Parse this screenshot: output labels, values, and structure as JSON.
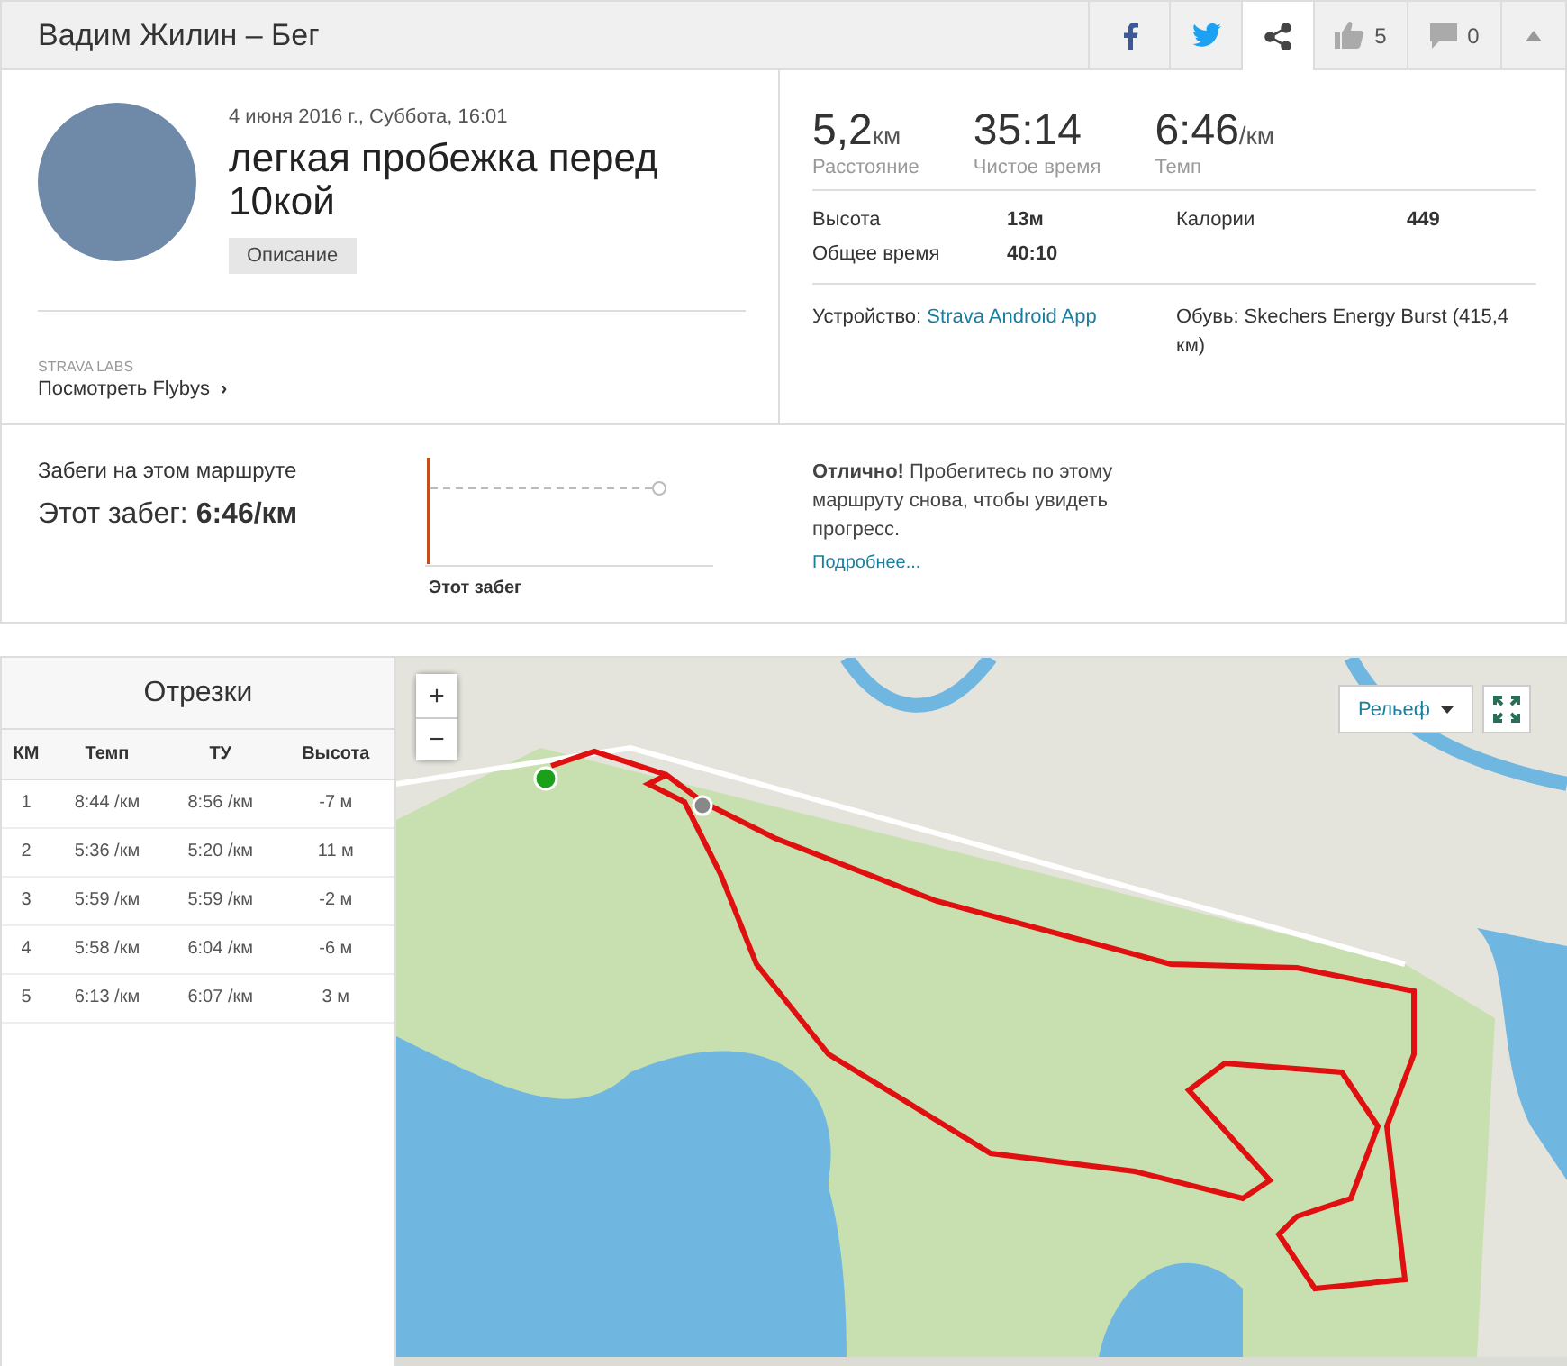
{
  "header": {
    "title": "Вадим Жилин – Бег",
    "kudos": "5",
    "comments": "0",
    "share_selected": true
  },
  "activity": {
    "date": "4 июня 2016 г., Суббота, 16:01",
    "name": "легкая пробежка перед 10кой",
    "description_button": "Описание",
    "labs_caption": "STRAVA LABS",
    "flybys_link": "Посмотреть Flybys",
    "flybys_arrow": "›"
  },
  "stats": {
    "primary": [
      {
        "value": "5,2",
        "unit": "км",
        "label": "Расстояние"
      },
      {
        "value": "35:14",
        "label": "Чистое время"
      },
      {
        "value": "6:46",
        "unit": "/км",
        "label": "Темп"
      }
    ],
    "details": [
      {
        "label": "Высота",
        "value": "13м"
      },
      {
        "label": "Калории",
        "value": "449"
      },
      {
        "label": "Общее время",
        "value": "40:10"
      }
    ],
    "device_label": "Устройство:",
    "device_value": "Strava Android App",
    "shoes": "Обувь: Skechers Energy Burst (415,4 км)"
  },
  "route": {
    "title": "Забеги на этом маршруте",
    "this_run_label": "Этот забег:",
    "this_run_value": "6:46/км",
    "chart_caption": "Этот забег",
    "message": "**Отлично!** Пробегитесь по этому маршруту снова, чтобы увидеть прогресс.",
    "more_link": "Подробнее..."
  },
  "splits": {
    "title": "Отрезки",
    "columns": [
      "КМ",
      "Темп",
      "ТУ",
      "Высота"
    ],
    "rows": [
      [
        "1",
        "8:44 /км",
        "8:56 /км",
        "-7 м"
      ],
      [
        "2",
        "5:36 /км",
        "5:20 /км",
        "11 м"
      ],
      [
        "3",
        "5:59 /км",
        "5:59 /км",
        "-2 м"
      ],
      [
        "4",
        "5:58 /км",
        "6:04 /км",
        "-6 м"
      ],
      [
        "5",
        "6:13 /км",
        "6:07 /км",
        "3 м"
      ]
    ]
  },
  "map": {
    "zoom_in": "+",
    "zoom_out": "−",
    "layer_select": "Рельеф"
  }
}
